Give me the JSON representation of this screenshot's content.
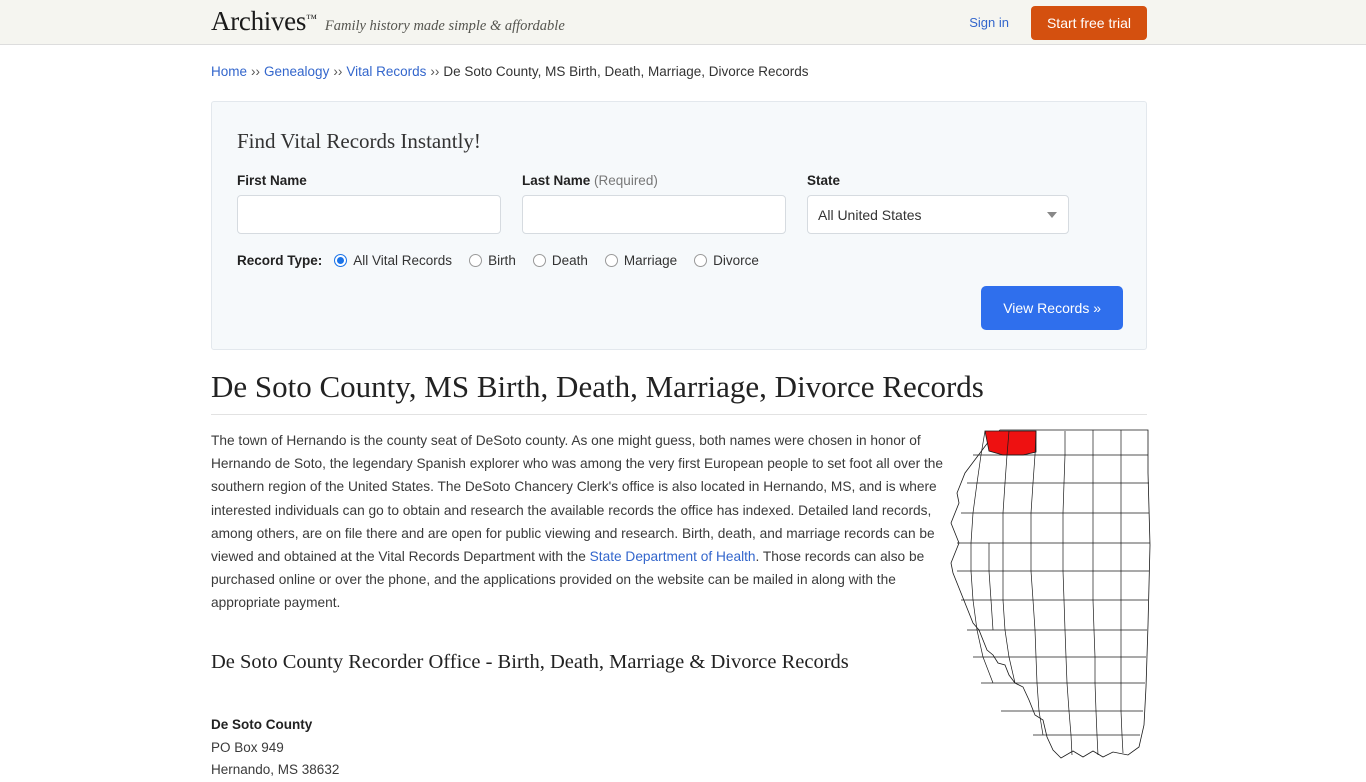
{
  "header": {
    "logo": "Archives",
    "trademark": "™",
    "tagline": "Family history made simple & affordable",
    "sign_in": "Sign in",
    "start_trial": "Start free trial",
    "trial_color": "#d4500f",
    "link_color": "#3366cc"
  },
  "breadcrumb": {
    "separator": "››",
    "items": [
      {
        "label": "Home",
        "link": true
      },
      {
        "label": "Genealogy",
        "link": true
      },
      {
        "label": "Vital Records",
        "link": true
      },
      {
        "label": "De Soto County, MS Birth, Death, Marriage, Divorce Records",
        "link": false
      }
    ]
  },
  "search_panel": {
    "title": "Find Vital Records Instantly!",
    "first_name": {
      "label": "First Name",
      "value": "",
      "placeholder": ""
    },
    "last_name": {
      "label": "Last Name",
      "required_note": "(Required)",
      "value": "",
      "placeholder": ""
    },
    "state": {
      "label": "State",
      "selected": "All United States",
      "caret_icon": "chevron-down-icon"
    },
    "record_type": {
      "label": "Record Type:",
      "options": [
        {
          "label": "All Vital Records",
          "checked": true
        },
        {
          "label": "Birth",
          "checked": false
        },
        {
          "label": "Death",
          "checked": false
        },
        {
          "label": "Marriage",
          "checked": false
        },
        {
          "label": "Divorce",
          "checked": false
        }
      ]
    },
    "submit_label": "View Records »",
    "submit_color": "#2f6fed"
  },
  "main": {
    "title": "De Soto County, MS Birth, Death, Marriage, Divorce Records",
    "paragraph_part1": "The town of Hernando is the county seat of DeSoto county. As one might guess, both names were chosen in honor of Hernando de Soto, the legendary Spanish explorer who was among the very first European people to set foot all over the southern region of the United States. The DeSoto Chancery Clerk's office is also located in Hernando, MS, and is where interested individuals can go to obtain and research the available records the office has indexed. Detailed land records, among others, are on file there and are open for public viewing and research. Birth, death, and marriage records can be viewed and obtained at the Vital Records Department with the ",
    "paragraph_link": "State Department of Health",
    "paragraph_part2": ". Those records can also be purchased online or over the phone, and the applications provided on the website can be mailed in along with the appropriate payment.",
    "sub_title": "De Soto County Recorder Office - Birth, Death, Marriage & Divorce Records",
    "address": {
      "name": "De Soto County",
      "line1": "PO Box 949",
      "line2": "Hernando, MS 38632"
    }
  },
  "map": {
    "name": "mississippi-county-map",
    "highlight_county": "De Soto",
    "highlight_color": "#ee1111",
    "outline_color": "#000000"
  }
}
